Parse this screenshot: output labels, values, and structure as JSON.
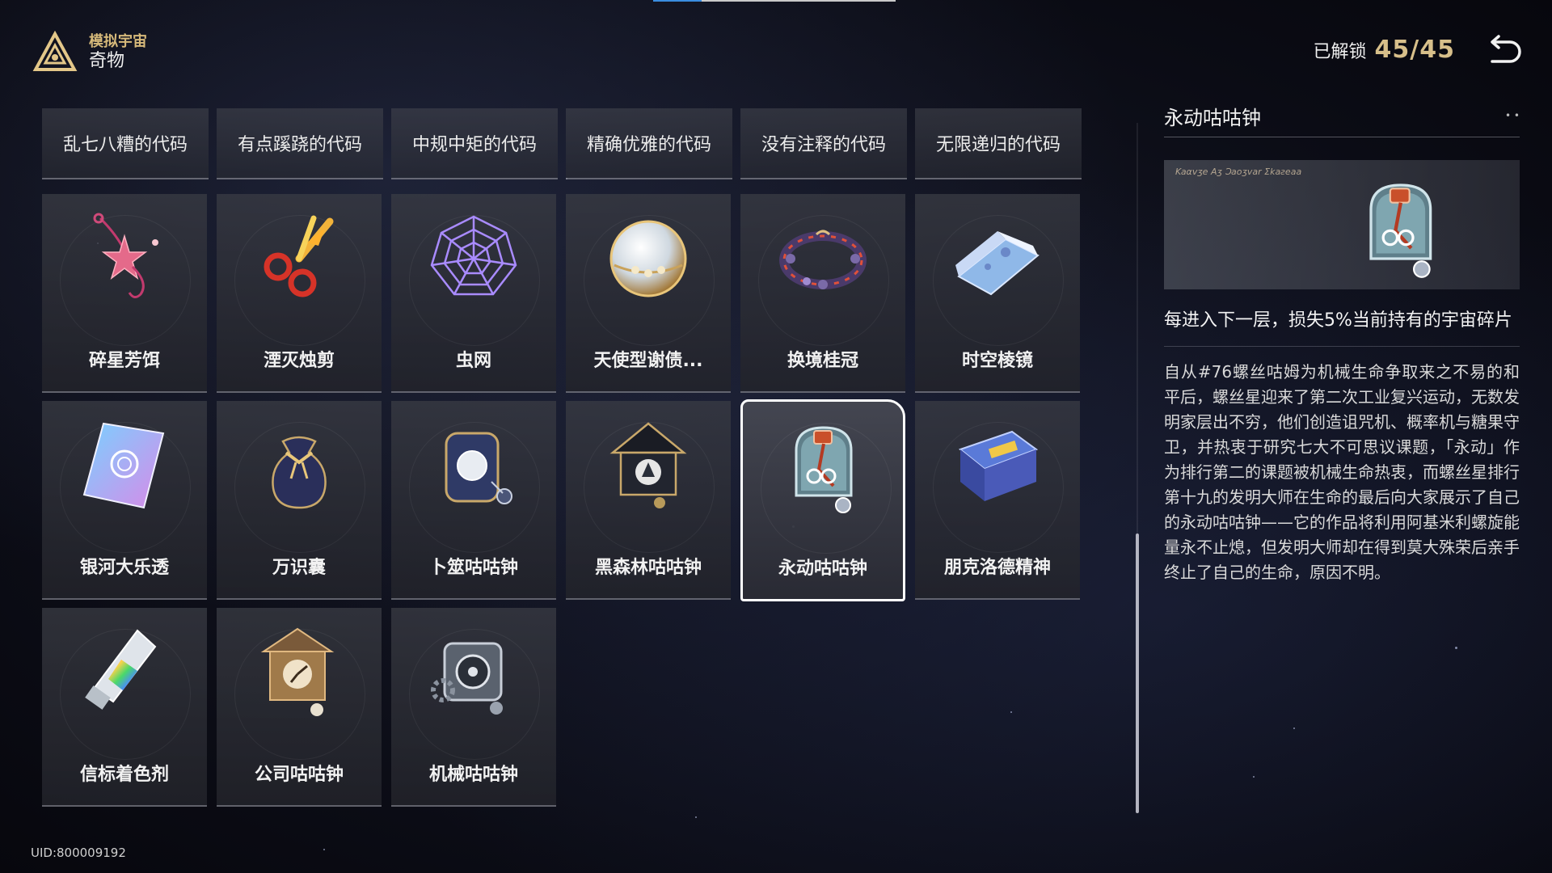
{
  "header": {
    "brand_sub": "模拟宇宙",
    "brand_title": "奇物",
    "unlock_label": "已解锁",
    "unlock_count": "45/45",
    "progress_fraction": 0.2
  },
  "tabs": [
    {
      "label": "乱七八糟的代码"
    },
    {
      "label": "有点蹊跷的代码"
    },
    {
      "label": "中规中矩的代码"
    },
    {
      "label": "精确优雅的代码"
    },
    {
      "label": "没有注释的代码"
    },
    {
      "label": "无限递归的代码"
    }
  ],
  "items": [
    {
      "label": "碎星芳饵",
      "icon": "star-lure-icon"
    },
    {
      "label": "湮灭烛剪",
      "icon": "scissors-icon"
    },
    {
      "label": "虫网",
      "icon": "spider-web-icon"
    },
    {
      "label": "天使型谢债...",
      "icon": "orb-icon"
    },
    {
      "label": "换境桂冠",
      "icon": "wreath-icon"
    },
    {
      "label": "时空棱镜",
      "icon": "prism-icon"
    },
    {
      "label": "银河大乐透",
      "icon": "lottery-ticket-icon"
    },
    {
      "label": "万识囊",
      "icon": "pouch-icon"
    },
    {
      "label": "卜筮咕咕钟",
      "icon": "divination-clock-icon"
    },
    {
      "label": "黑森林咕咕钟",
      "icon": "black-forest-clock-icon"
    },
    {
      "label": "永动咕咕钟",
      "icon": "perpetual-clock-icon",
      "selected": true
    },
    {
      "label": "朋克洛德精神",
      "icon": "punklorde-box-icon"
    },
    {
      "label": "信标着色剂",
      "icon": "paint-tube-icon"
    },
    {
      "label": "公司咕咕钟",
      "icon": "company-clock-icon"
    },
    {
      "label": "机械咕咕钟",
      "icon": "mechanical-clock-icon"
    }
  ],
  "detail": {
    "title": "永动咕咕钟",
    "dots": "• •",
    "effect": "每进入下一层，损失5%当前持有的宇宙碎片",
    "lore": "自从#76螺丝咕姆为机械生命争取来之不易的和平后，螺丝星迎来了第二次工业复兴运动，无数发明家层出不穷，他们创造诅咒机、概率机与糖果守卫，并热衷于研究七大不可思议课题，「永动」作为排行第二的课题被机械生命热衷，而螺丝星排行第十九的发明大师在生命的最后向大家展示了自己的永动咕咕钟——它的作品将利用阿基米利螺旋能量永不止熄，但发明大师却在得到莫大殊荣后亲手终止了自己的生命，原因不明。"
  },
  "uid": "UID:800009192",
  "colors": {
    "accent_gold": "#d7bf8a",
    "selected_border": "#ffffff",
    "progress_blue": "#3a8de0"
  }
}
